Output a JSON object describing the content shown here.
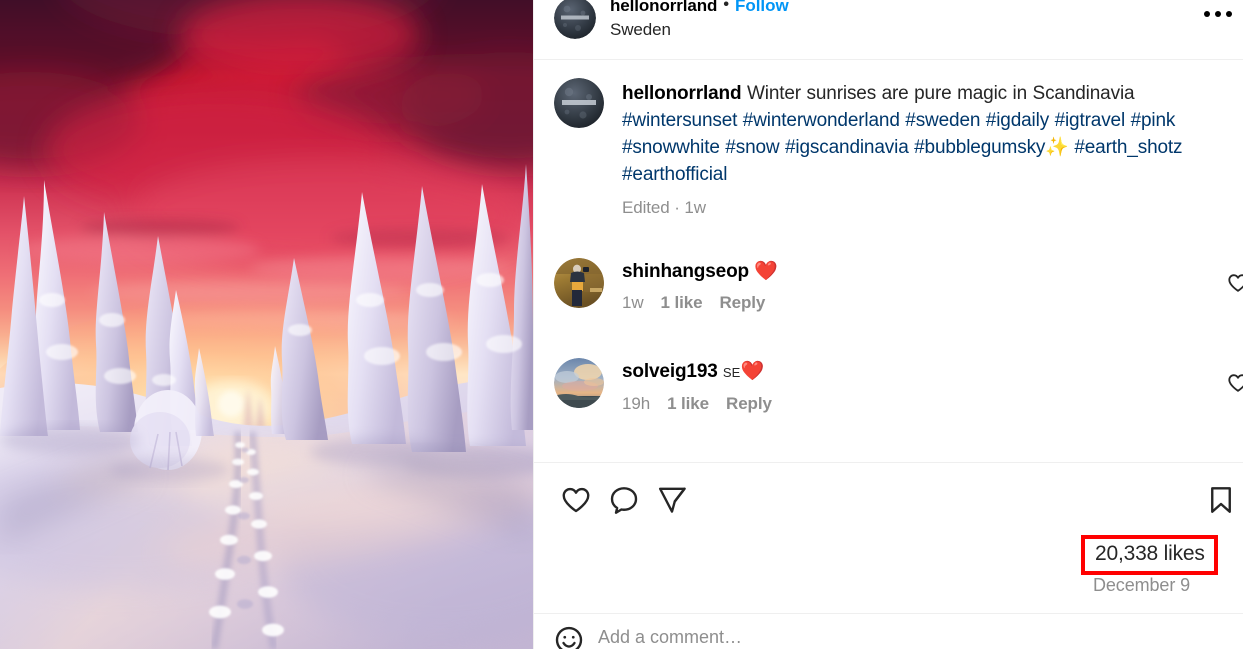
{
  "post": {
    "header": {
      "username": "hellonorrland",
      "follow_label": "Follow",
      "location": "Sweden",
      "more_icon": "ellipsis-horizontal-icon"
    },
    "caption": {
      "username": "hellonorrland",
      "text": "Winter sunrises are pure magic in Scandinavia",
      "hashtags_line1": "#wintersunset #winterwonderland #sweden #igdaily #igtravel",
      "hashtags_line2": "#pink #snowwhite #snow #igscandinavia #bubblegumsky",
      "emoji": "✨",
      "hashtags_line3": "#earth_shotz #earthofficial",
      "meta": "Edited · 1w"
    },
    "comments": [
      {
        "username": "shinhangseop",
        "text": "❤️",
        "prefix": "",
        "time": "1w",
        "likes": "1 like",
        "reply": "Reply",
        "like_icon": "heart-outline-icon"
      },
      {
        "username": "solveig193",
        "prefix": "SE",
        "text": "❤️",
        "time": "19h",
        "likes": "1 like",
        "reply": "Reply",
        "like_icon": "heart-outline-icon"
      }
    ],
    "actions": {
      "like_icon": "heart-outline-icon",
      "comment_icon": "speech-bubble-icon",
      "share_icon": "paper-plane-icon",
      "save_icon": "bookmark-outline-icon"
    },
    "engagement": {
      "likes": "20,338 likes",
      "date": "December 9"
    },
    "add_comment": {
      "emoji_icon": "smiley-face-icon",
      "placeholder": "Add a comment…"
    },
    "annotation": {
      "highlight_color": "#ff0000",
      "target": "likes-count"
    }
  },
  "photo": {
    "alt_name": "winter-sunset-forest-path-photo",
    "colors": {
      "sky_top": "#5d1b32",
      "sky_crimson": "#c9183a",
      "sky_pink": "#f2657a",
      "sun_glow": "#ffd9a0",
      "snow_light": "#eae6f2",
      "snow_shadow": "#bcb5d6",
      "tree": "#e8e6f5"
    }
  },
  "theme": {
    "link_blue": "#0095f6",
    "hashtag_blue": "#00376b",
    "muted_gray": "#8e8e8e",
    "text_dark": "#262626",
    "divider": "#efefef"
  }
}
